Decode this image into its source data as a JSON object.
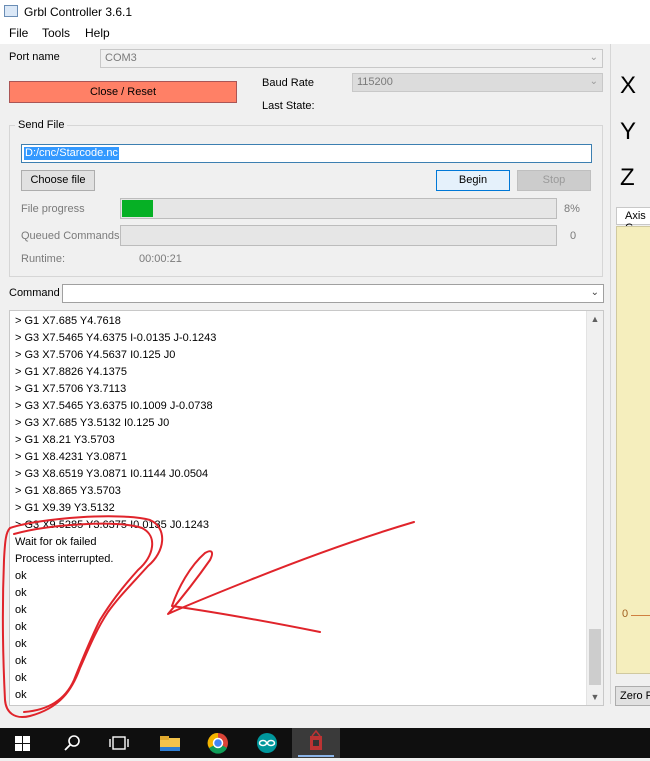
{
  "window": {
    "title": "Grbl Controller 3.6.1"
  },
  "menu": {
    "items": [
      "File",
      "Tools",
      "Help"
    ]
  },
  "port": {
    "label": "Port name",
    "value": "COM3"
  },
  "baud": {
    "label": "Baud Rate",
    "value": "115200"
  },
  "close_button": "Close / Reset",
  "last_state_label": "Last State:",
  "send_file": {
    "group_title": "Send File",
    "path": "D:/cnc/Starcode.nc",
    "choose_label": "Choose file",
    "begin_label": "Begin",
    "stop_label": "Stop",
    "progress_label": "File progress",
    "progress_percent": 8,
    "progress_text": "8%",
    "queued_label": "Queued Commands",
    "queued_value": "0",
    "runtime_label": "Runtime:",
    "runtime_value": "00:00:21"
  },
  "command": {
    "label": "Command",
    "value": ""
  },
  "console_lines": [
    "> G1 X7.685 Y4.7618",
    "> G3 X7.5465 Y4.6375 I-0.0135 J-0.1243",
    "> G3 X7.5706 Y4.5637 I0.125 J0",
    "> G1 X7.8826 Y4.1375",
    "> G1 X7.5706 Y3.7113",
    "> G3 X7.5465 Y3.6375 I0.1009 J-0.0738",
    "> G3 X7.685 Y3.5132 I0.125 J0",
    "> G1 X8.21 Y3.5703",
    "> G1 X8.4231 Y3.0871",
    "> G3 X8.6519 Y3.0871 I0.1144 J0.0504",
    "> G1 X8.865 Y3.5703",
    "> G1 X9.39 Y3.5132",
    "> G3 X9.5285 Y3.6375 I0.0135 J0.1243",
    "Wait for ok failed",
    "Process interrupted.",
    "ok",
    "ok",
    "ok",
    "ok",
    "ok",
    "ok",
    "ok",
    "ok"
  ],
  "axes": {
    "x": "X",
    "y": "Y",
    "z": "Z"
  },
  "right_panel": {
    "tab_label": "Axis C",
    "plot_zero": "0",
    "zero_button": "Zero P"
  },
  "taskbar": {
    "icons": [
      "windows-start-icon",
      "search-icon",
      "task-view-icon",
      "file-explorer-icon",
      "chrome-icon",
      "arduino-icon",
      "grbl-app-icon"
    ]
  },
  "colors": {
    "close_button": "#ff8066",
    "progress_fill": "#06b025",
    "selection": "#3399ff",
    "plot_background": "#f5eebd",
    "annotation": "#e0242b"
  }
}
